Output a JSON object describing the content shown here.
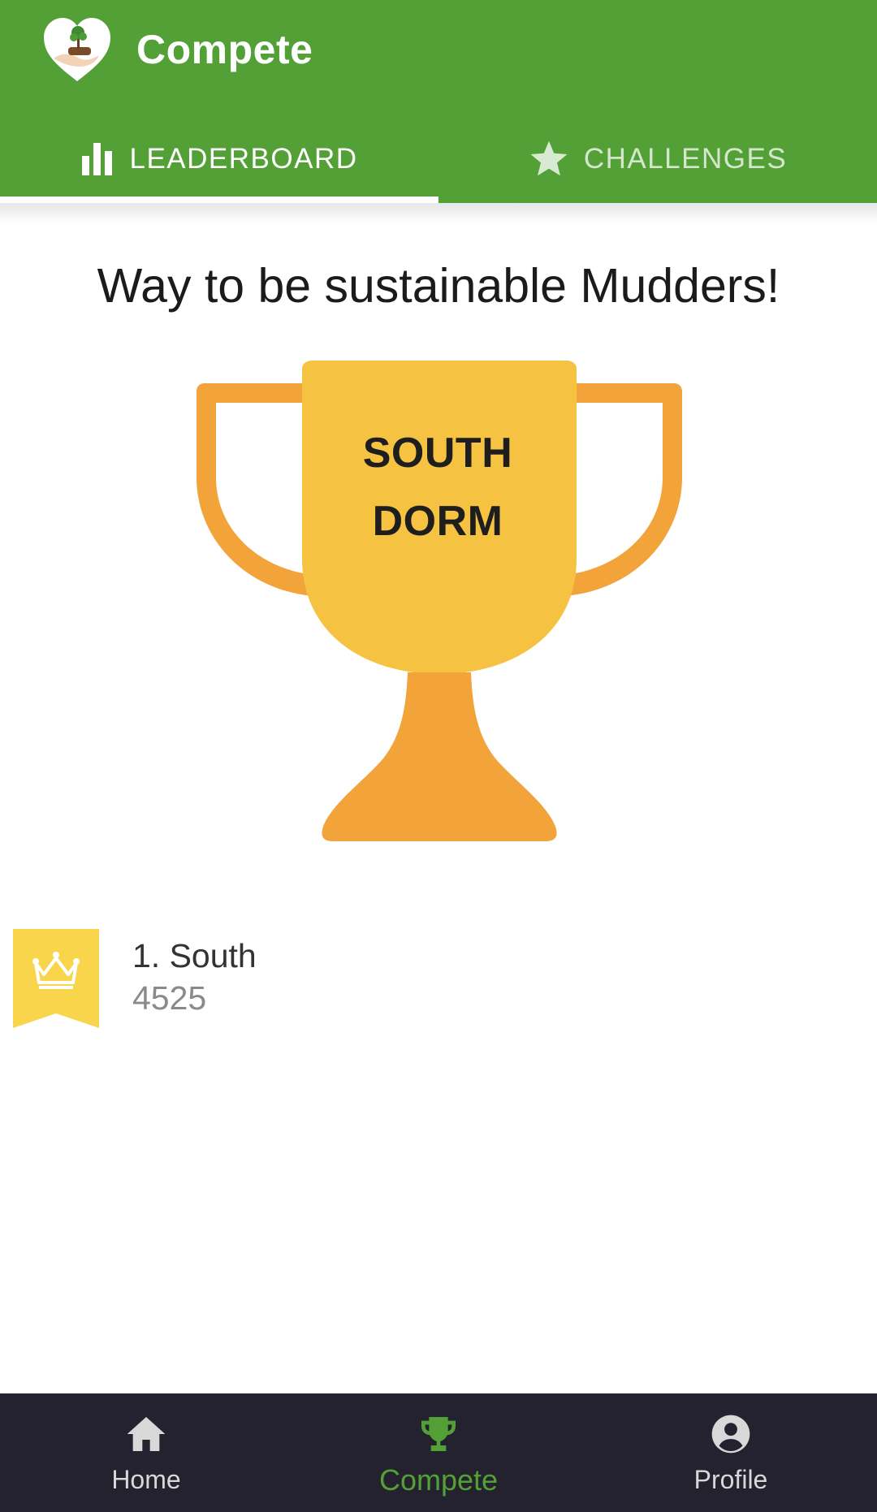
{
  "app": {
    "title": "Compete"
  },
  "tabs": [
    {
      "label": "LEADERBOARD",
      "icon": "bar-chart-icon",
      "active": true
    },
    {
      "label": "CHALLENGES",
      "icon": "star-icon",
      "active": false
    }
  ],
  "leaderboard": {
    "headline": "Way to be sustainable Mudders!",
    "trophy": {
      "line1": "SOUTH",
      "line2": "DORM"
    },
    "entries": [
      {
        "rank_name": "1. South",
        "score": "4525",
        "icon": "crown-icon"
      }
    ]
  },
  "bottom_nav": [
    {
      "label": "Home",
      "icon": "home-icon",
      "active": false
    },
    {
      "label": "Compete",
      "icon": "trophy-icon",
      "active": true
    },
    {
      "label": "Profile",
      "icon": "profile-icon",
      "active": false
    }
  ],
  "colors": {
    "primary_green": "#53a037",
    "trophy_cup": "#f5c242",
    "trophy_handles": "#f2a33a",
    "badge_yellow": "#f8d54b",
    "nav_background": "#23222e"
  }
}
